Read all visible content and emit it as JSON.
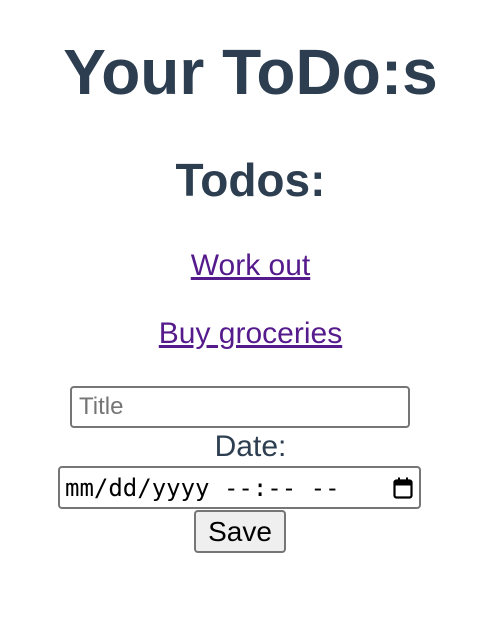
{
  "header": {
    "title": "Your ToDo:s"
  },
  "todos": {
    "heading": "Todos:",
    "items": [
      {
        "label": "Work out"
      },
      {
        "label": "Buy groceries"
      }
    ]
  },
  "form": {
    "title_placeholder": "Title",
    "title_value": "",
    "date_label": "Date:",
    "date_display": "mm/dd/yyyy --:-- --",
    "date_icon": "calendar-icon",
    "save_label": "Save"
  },
  "colors": {
    "heading_text": "#2c3e50",
    "link_visited": "#551a8b",
    "input_border": "#767676",
    "button_bg": "#efefef"
  }
}
